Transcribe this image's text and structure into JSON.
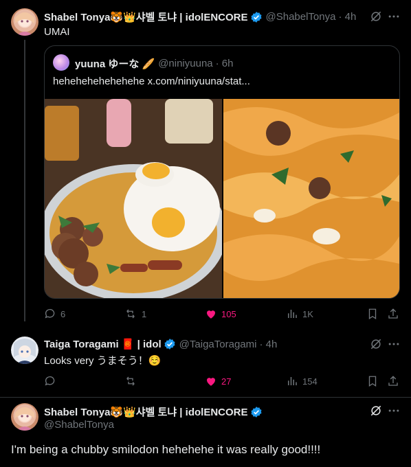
{
  "tweets": [
    {
      "name": "Shabel Tonya🐯👑샤벨 토냐 | idolENCORE",
      "handle": "@ShabelTonya",
      "time": "· 4h",
      "text": "UMAI",
      "quote": {
        "name": "yuuna ゆーな 🥖",
        "handle": "@niniyuuna",
        "time": "· 6h",
        "text": "hehehehehehehehe  x.com/niniyuuna/stat..."
      },
      "actions": {
        "replies": "6",
        "retweets": "1",
        "likes": "105",
        "views": "1K"
      }
    },
    {
      "name": "Taiga Toragami 🧧 | idol",
      "handle": "@TaigaToragami",
      "time": "· 4h",
      "text": "Looks very うまそう！☺️",
      "actions": {
        "replies": "",
        "retweets": "",
        "likes": "27",
        "views": "154"
      }
    },
    {
      "name": "Shabel Tonya🐯👑샤벨 토냐 | idolENCORE",
      "handle": "@ShabelTonya",
      "text": "I'm being a chubby smilodon hehehehe it was really good!!!!"
    }
  ],
  "colors": {
    "bg": "#000000",
    "text": "#e7e9ea",
    "muted": "#71767b",
    "like": "#f91880",
    "verified": "#1d9bf0",
    "border": "#2f3336"
  }
}
